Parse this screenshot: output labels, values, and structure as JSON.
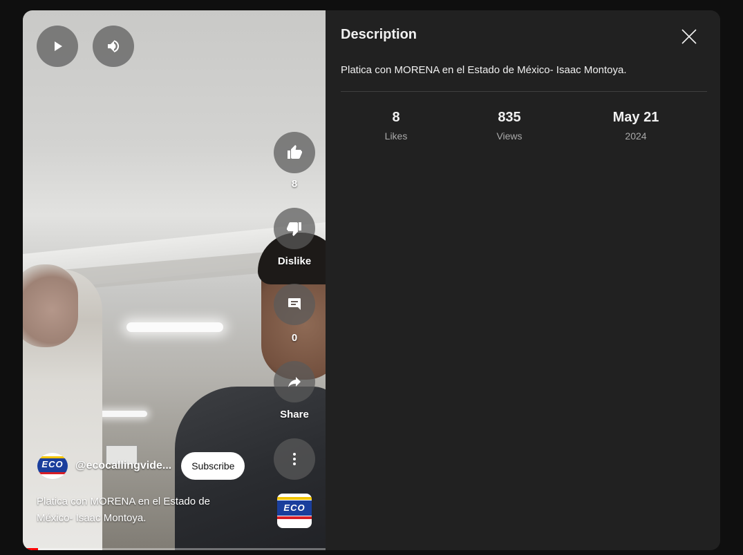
{
  "video": {
    "channel_handle": "@ecocallingvide...",
    "subscribe_label": "Subscribe",
    "title_line1": "Platica con MORENA en el Estado de",
    "title_line2": "México- Isaac Montoya.",
    "progress_fraction": 0.05,
    "actions": {
      "like_count": "8",
      "dislike_label": "Dislike",
      "comment_count": "0",
      "share_label": "Share"
    },
    "logo_text": "ECO"
  },
  "description_panel": {
    "title": "Description",
    "text": "Platica con MORENA en el Estado de México- Isaac Montoya.",
    "stats": [
      {
        "value": "8",
        "label": "Likes"
      },
      {
        "value": "835",
        "label": "Views"
      },
      {
        "value": "May 21",
        "label": "2024"
      }
    ]
  },
  "icons": [
    "play-icon",
    "volume-icon",
    "thumbs-up-icon",
    "thumbs-down-icon",
    "comment-icon",
    "share-icon",
    "more-vert-icon",
    "close-icon"
  ],
  "colors": {
    "background": "#0f0f0f",
    "panel": "#212121",
    "progress": "#ff0000"
  }
}
